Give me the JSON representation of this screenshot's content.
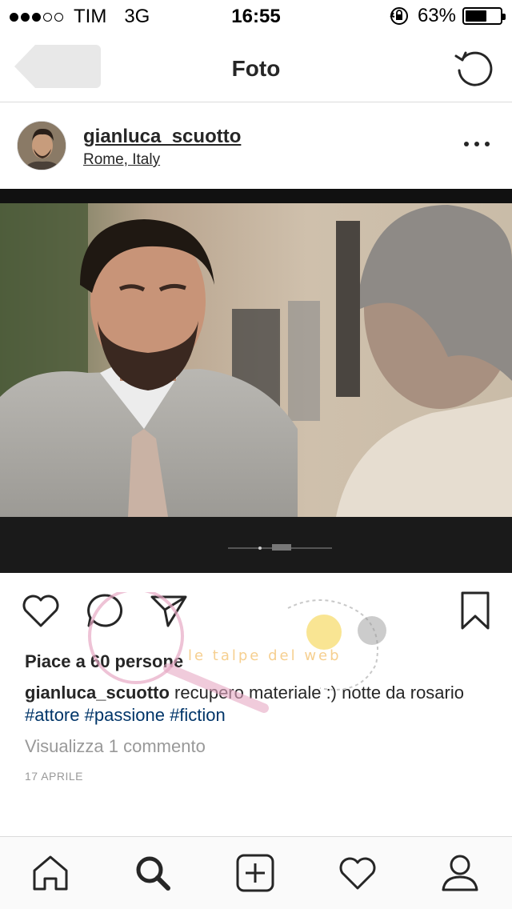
{
  "status_bar": {
    "carrier": "TIM",
    "network": "3G",
    "time": "16:55",
    "battery_percent": "63%",
    "battery_level": 0.63,
    "signal_bars_filled": 3,
    "signal_bars_total": 5
  },
  "nav": {
    "title": "Foto",
    "back_icon": "back-arrow-icon",
    "refresh_icon": "refresh-icon"
  },
  "post": {
    "username": "gianluca_scuotto",
    "location": "Rome, Italy",
    "likes_text": "Piace a 60 persone",
    "caption_user": "gianluca_scuotto",
    "caption_text": " recupero materiale :) notte da rosario ",
    "hashtags": [
      "#attore",
      "#passione",
      "#fiction"
    ],
    "view_comments": "Visualizza 1 commento",
    "date": "17 APRILE"
  },
  "watermark": {
    "text": "le talpe del web"
  },
  "colors": {
    "text": "#262626",
    "hashtag": "#003569",
    "secondary": "#999999",
    "divider": "#dbdbdb"
  },
  "tab_bar": {
    "icons": [
      "home-icon",
      "search-icon",
      "add-icon",
      "heart-icon",
      "profile-icon"
    ]
  }
}
